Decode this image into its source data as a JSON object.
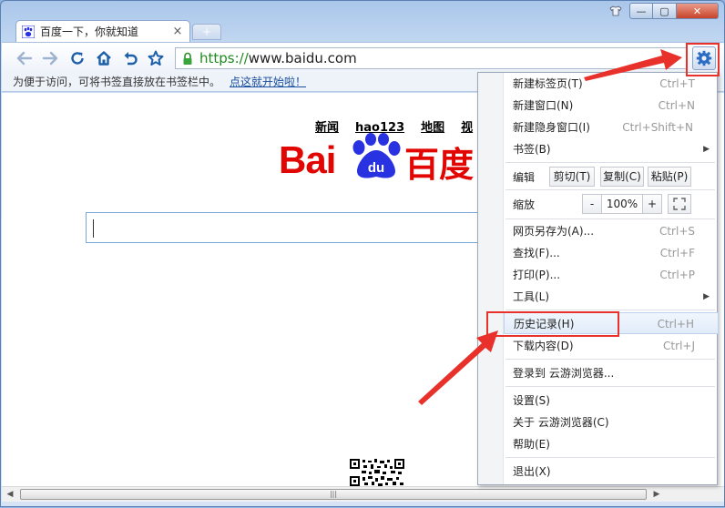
{
  "tab": {
    "title": "百度一下，你就知道",
    "close": "×",
    "newtab": "+"
  },
  "window_controls": {
    "minimize": "—",
    "maximize": "▢",
    "close": "✕"
  },
  "address_bar": {
    "scheme": "https://",
    "host": "www.baidu.com"
  },
  "bookmark_bar": {
    "hint": "为便于访问，可将书签直接放在书签栏中。",
    "link": "点这就开始啦！"
  },
  "page": {
    "top_links": [
      "新闻",
      "hao123",
      "地图",
      "视"
    ],
    "logo_latin": "Bai",
    "logo_paw": "du",
    "logo_cn": "百度"
  },
  "menu": {
    "items": [
      {
        "label": "新建标签页(T)",
        "shortcut": "Ctrl+T"
      },
      {
        "label": "新建窗口(N)",
        "shortcut": "Ctrl+N"
      },
      {
        "label": "新建隐身窗口(I)",
        "shortcut": "Ctrl+Shift+N"
      },
      {
        "label": "书签(B)",
        "shortcut": ""
      },
      {
        "label": "网页另存为(A)...",
        "shortcut": "Ctrl+S"
      },
      {
        "label": "查找(F)...",
        "shortcut": "Ctrl+F"
      },
      {
        "label": "打印(P)...",
        "shortcut": "Ctrl+P"
      },
      {
        "label": "工具(L)",
        "shortcut": ""
      },
      {
        "label": "历史记录(H)",
        "shortcut": "Ctrl+H"
      },
      {
        "label": "下载内容(D)",
        "shortcut": "Ctrl+J"
      },
      {
        "label": "登录到 云游浏览器...",
        "shortcut": ""
      },
      {
        "label": "设置(S)",
        "shortcut": ""
      },
      {
        "label": "关于 云游浏览器(C)",
        "shortcut": ""
      },
      {
        "label": "帮助(E)",
        "shortcut": ""
      },
      {
        "label": "退出(X)",
        "shortcut": ""
      }
    ],
    "edit": {
      "label": "编辑",
      "cut": "剪切(T)",
      "copy": "复制(C)",
      "paste": "粘贴(P)"
    },
    "zoom": {
      "label": "缩放",
      "minus": "-",
      "value": "100%",
      "plus": "+"
    }
  },
  "colors": {
    "accent": "#e8312b",
    "baidu_red": "#e10601",
    "baidu_blue": "#2932e1",
    "secure_green": "#1f8a1f"
  }
}
